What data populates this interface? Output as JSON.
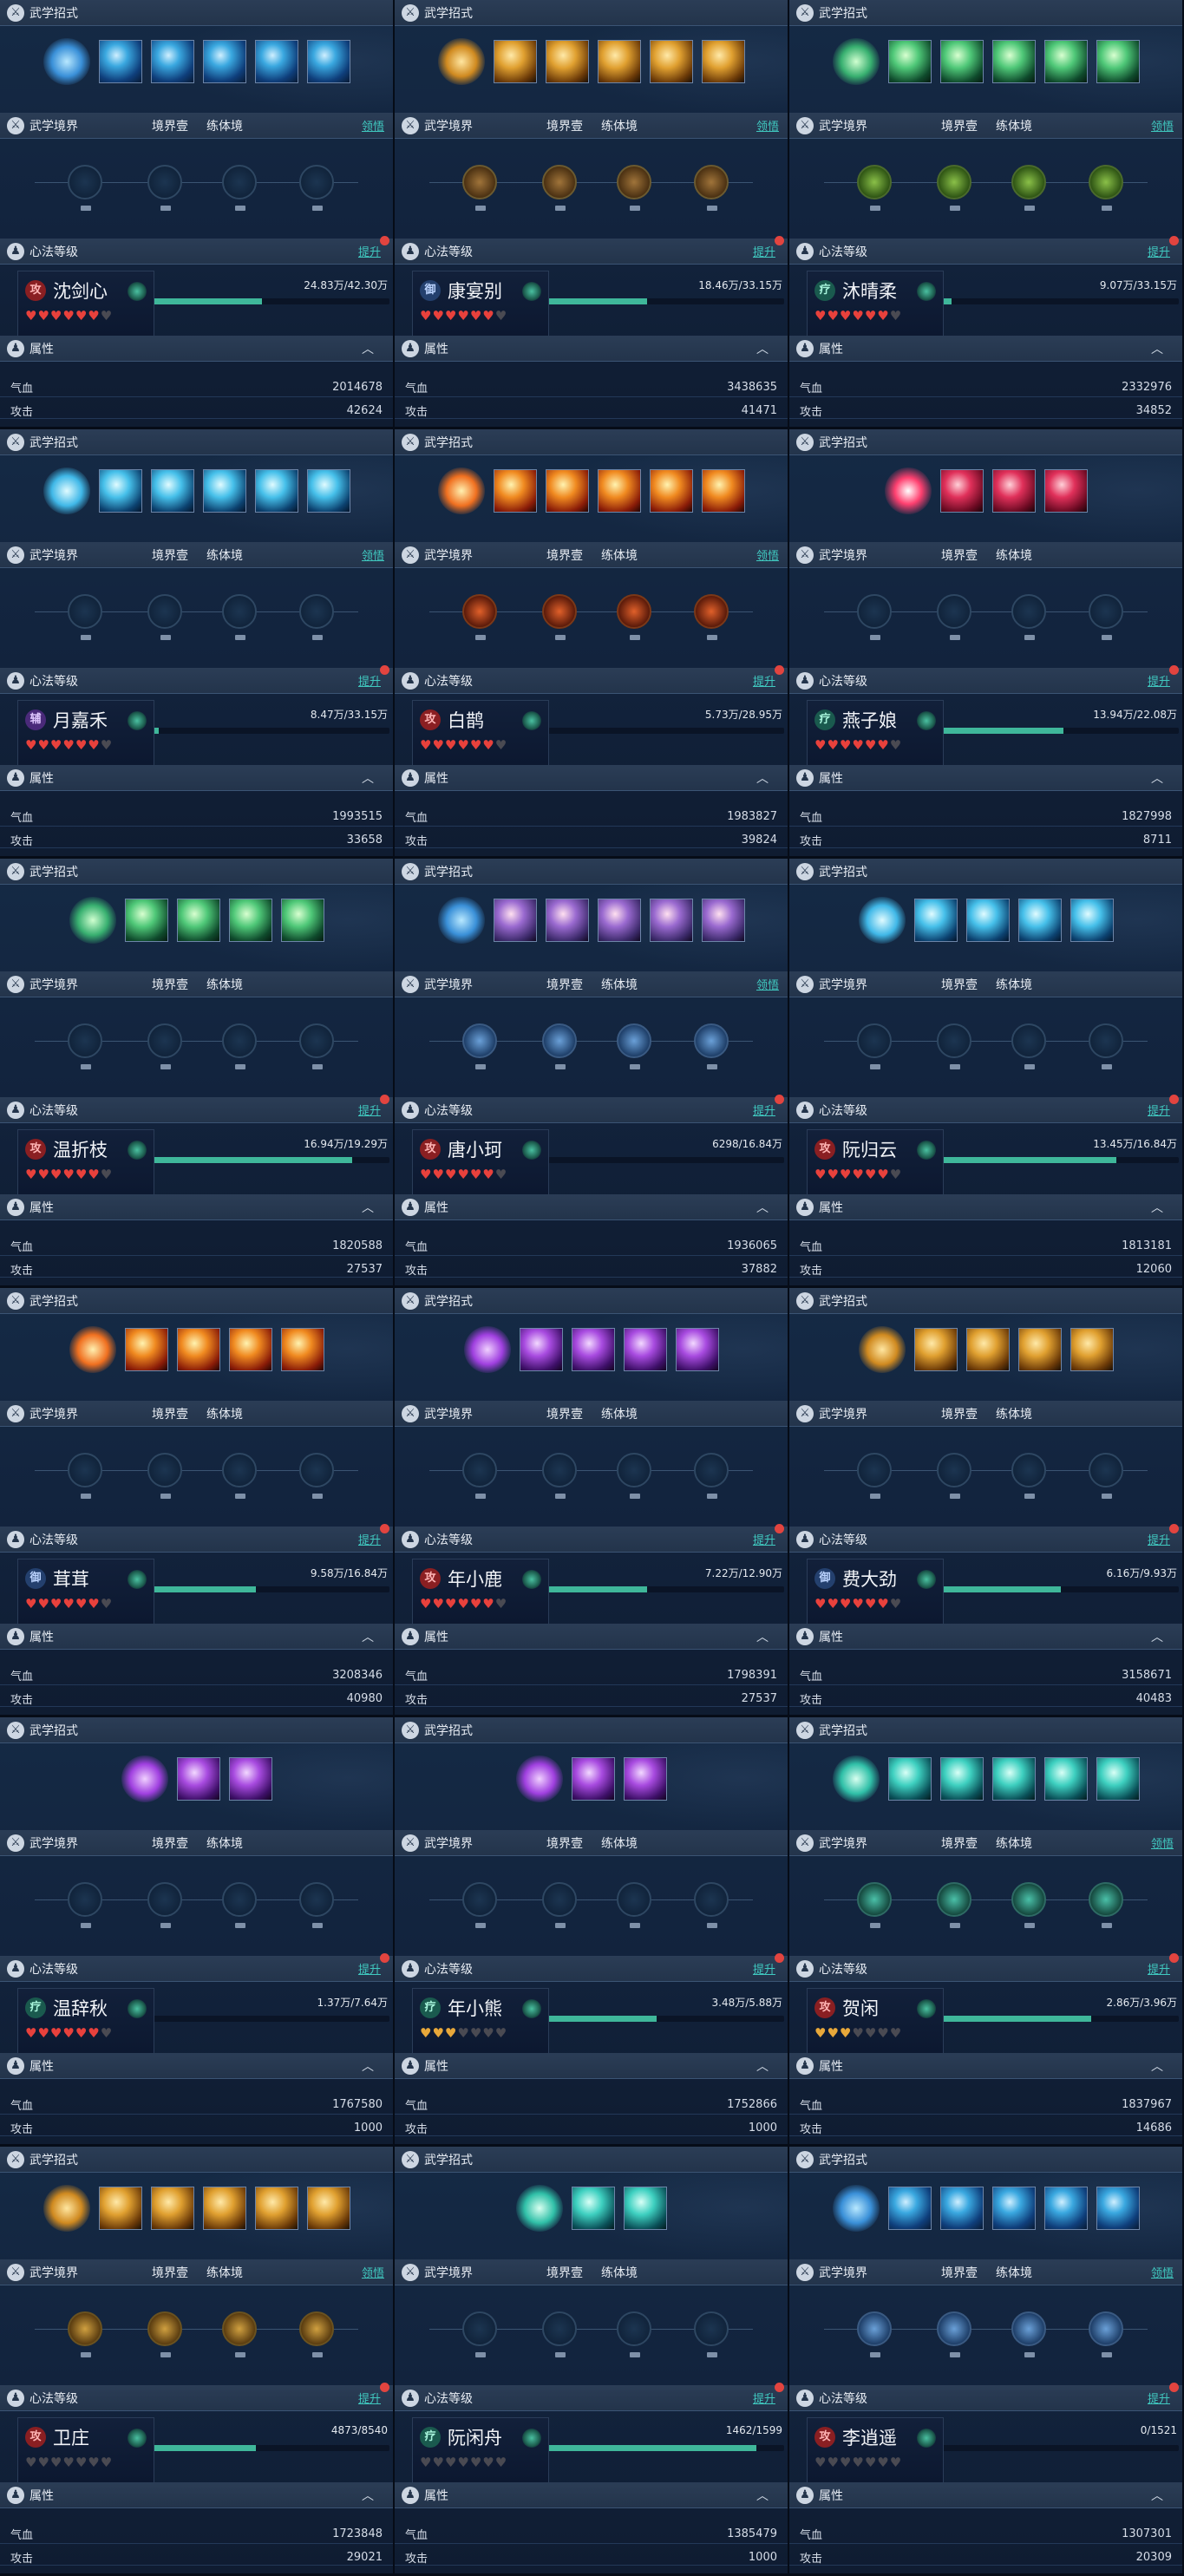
{
  "labels": {
    "moves": "武学招式",
    "realm": "武学境界",
    "realm_level": "境界壹",
    "realm_body": "练体境",
    "comprehend": "领悟",
    "heart": "心法等级",
    "upgrade": "提升",
    "attrs": "属性",
    "hp_label": "气血",
    "atk_label": "攻击"
  },
  "cards": [
    {
      "name": "沈剑心",
      "badge": "攻",
      "badge_color": "red",
      "xp": "24.83万/42.30万",
      "xp_fraction": 0.59,
      "hp": "2014678",
      "atk": "42624",
      "hearts_filled": 6,
      "hearts_total": 7,
      "heart_color": "red",
      "skill_theme": "blue",
      "skill_count": 6,
      "node_style": "",
      "show_comprehend": true
    },
    {
      "name": "康宴别",
      "badge": "御",
      "badge_color": "blue",
      "xp": "18.46万/33.15万",
      "xp_fraction": 0.56,
      "hp": "3438635",
      "atk": "41471",
      "hearts_filled": 6,
      "hearts_total": 7,
      "heart_color": "red",
      "skill_theme": "gold",
      "skill_count": 6,
      "node_style": "lit",
      "show_comprehend": true
    },
    {
      "name": "沐晴柔",
      "badge": "疗",
      "badge_color": "teal",
      "xp": "9.07万/33.15万",
      "xp_fraction": 0.27,
      "hp": "2332976",
      "atk": "34852",
      "hearts_filled": 6,
      "hearts_total": 7,
      "heart_color": "red",
      "skill_theme": "green",
      "skill_count": 6,
      "node_style": "lit-green",
      "show_comprehend": true
    },
    {
      "name": "月嘉禾",
      "badge": "辅",
      "badge_color": "purple",
      "xp": "8.47万/33.15万",
      "xp_fraction": 0.26,
      "hp": "1993515",
      "atk": "33658",
      "hearts_filled": 6,
      "hearts_total": 7,
      "heart_color": "red",
      "skill_theme": "cyan",
      "skill_count": 6,
      "node_style": "",
      "show_comprehend": true
    },
    {
      "name": "白鹊",
      "badge": "攻",
      "badge_color": "red",
      "xp": "5.73万/28.95万",
      "xp_fraction": 0.2,
      "hp": "1983827",
      "atk": "39824",
      "hearts_filled": 6,
      "hearts_total": 7,
      "heart_color": "red",
      "skill_theme": "fire",
      "skill_count": 6,
      "node_style": "lit-fire",
      "show_comprehend": true
    },
    {
      "name": "燕子娘",
      "badge": "疗",
      "badge_color": "teal",
      "xp": "13.94万/22.08万",
      "xp_fraction": 0.63,
      "hp": "1827998",
      "atk": "8711",
      "hearts_filled": 6,
      "hearts_total": 7,
      "heart_color": "red",
      "skill_theme": "red",
      "skill_count": 4,
      "node_style": "",
      "show_comprehend": false
    },
    {
      "name": "温折枝",
      "badge": "攻",
      "badge_color": "red",
      "xp": "16.94万/19.29万",
      "xp_fraction": 0.88,
      "hp": "1820588",
      "atk": "27537",
      "hearts_filled": 6,
      "hearts_total": 7,
      "heart_color": "red",
      "skill_theme": "green",
      "skill_count": 5,
      "node_style": "",
      "show_comprehend": false
    },
    {
      "name": "唐小珂",
      "badge": "攻",
      "badge_color": "red",
      "xp": "6298/16.84万",
      "xp_fraction": 0.04,
      "hp": "1936065",
      "atk": "37882",
      "hearts_filled": 6,
      "hearts_total": 7,
      "heart_color": "red",
      "skill_theme": "mix",
      "skill_count": 6,
      "node_style": "lit-blue",
      "show_comprehend": true
    },
    {
      "name": "阮归云",
      "badge": "攻",
      "badge_color": "red",
      "xp": "13.45万/16.84万",
      "xp_fraction": 0.8,
      "hp": "1813181",
      "atk": "12060",
      "hearts_filled": 6,
      "hearts_total": 7,
      "heart_color": "red",
      "skill_theme": "cyan",
      "skill_count": 5,
      "node_style": "",
      "show_comprehend": false
    },
    {
      "name": "茸茸",
      "badge": "御",
      "badge_color": "blue",
      "xp": "9.58万/16.84万",
      "xp_fraction": 0.57,
      "hp": "3208346",
      "atk": "40980",
      "hearts_filled": 6,
      "hearts_total": 7,
      "heart_color": "red",
      "skill_theme": "fire",
      "skill_count": 5,
      "node_style": "",
      "show_comprehend": false
    },
    {
      "name": "年小鹿",
      "badge": "攻",
      "badge_color": "red",
      "xp": "7.22万/12.90万",
      "xp_fraction": 0.56,
      "hp": "1798391",
      "atk": "27537",
      "hearts_filled": 6,
      "hearts_total": 7,
      "heart_color": "red",
      "skill_theme": "purple",
      "skill_count": 5,
      "node_style": "",
      "show_comprehend": false
    },
    {
      "name": "费大劲",
      "badge": "御",
      "badge_color": "blue",
      "xp": "6.16万/9.93万",
      "xp_fraction": 0.62,
      "hp": "3158671",
      "atk": "40483",
      "hearts_filled": 6,
      "hearts_total": 7,
      "heart_color": "red",
      "skill_theme": "gold",
      "skill_count": 5,
      "node_style": "",
      "show_comprehend": false
    },
    {
      "name": "温辞秋",
      "badge": "疗",
      "badge_color": "teal",
      "xp": "1.37万/7.64万",
      "xp_fraction": 0.18,
      "hp": "1767580",
      "atk": "1000",
      "hearts_filled": 6,
      "hearts_total": 7,
      "heart_color": "red",
      "skill_theme": "purple",
      "skill_count": 3,
      "node_style": "",
      "show_comprehend": false
    },
    {
      "name": "年小熊",
      "badge": "疗",
      "badge_color": "teal",
      "xp": "3.48万/5.88万",
      "xp_fraction": 0.59,
      "hp": "1752866",
      "atk": "1000",
      "hearts_filled": 3,
      "hearts_total": 7,
      "heart_color": "gold",
      "skill_theme": "purple",
      "skill_count": 3,
      "node_style": "",
      "show_comprehend": false
    },
    {
      "name": "贺闲",
      "badge": "攻",
      "badge_color": "red",
      "xp": "2.86万/3.96万",
      "xp_fraction": 0.72,
      "hp": "1837967",
      "atk": "14686",
      "hearts_filled": 3,
      "hearts_total": 7,
      "heart_color": "gold",
      "skill_theme": "teal",
      "skill_count": 6,
      "node_style": "lit-teal",
      "show_comprehend": true
    },
    {
      "name": "卫庄",
      "badge": "攻",
      "badge_color": "red",
      "xp": "4873/8540",
      "xp_fraction": 0.57,
      "hp": "1723848",
      "atk": "29021",
      "hearts_filled": 0,
      "hearts_total": 7,
      "heart_color": "red",
      "skill_theme": "gold",
      "skill_count": 6,
      "node_style": "lit-gold",
      "show_comprehend": true
    },
    {
      "name": "阮闲舟",
      "badge": "疗",
      "badge_color": "teal",
      "xp": "1462/1599",
      "xp_fraction": 0.91,
      "hp": "1385479",
      "atk": "1000",
      "hearts_filled": 0,
      "hearts_total": 7,
      "heart_color": "red",
      "skill_theme": "teal",
      "skill_count": 3,
      "node_style": "",
      "show_comprehend": false
    },
    {
      "name": "李逍遥",
      "badge": "攻",
      "badge_color": "red",
      "xp": "0/1521",
      "xp_fraction": 0,
      "hp": "1307301",
      "atk": "20309",
      "hearts_filled": 0,
      "hearts_total": 7,
      "heart_color": "red",
      "skill_theme": "blue",
      "skill_count": 6,
      "node_style": "lit-blue",
      "show_comprehend": true
    }
  ]
}
